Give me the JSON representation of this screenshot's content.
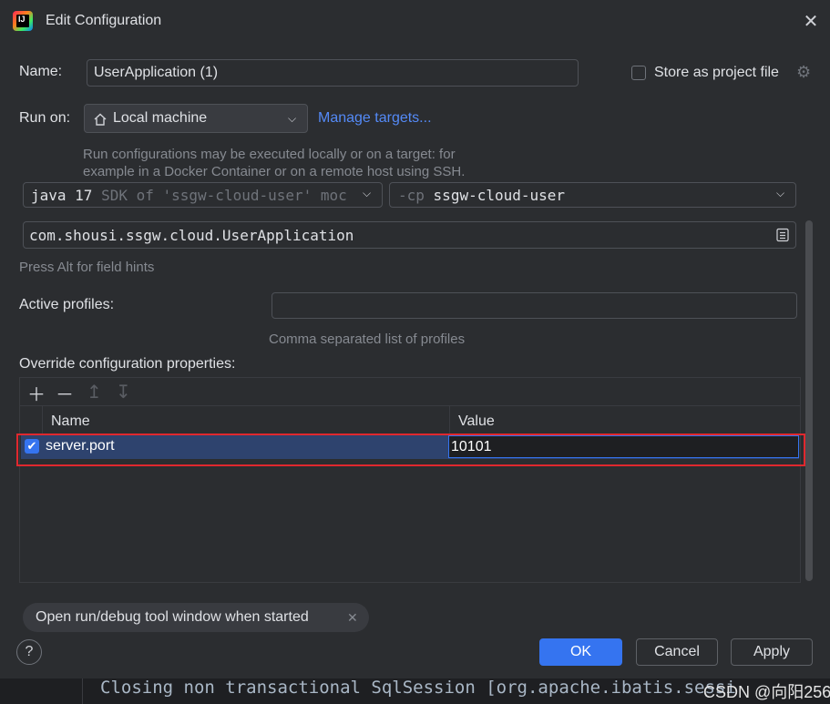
{
  "window": {
    "title": "Edit Configuration",
    "icon": "intellij-idea-icon",
    "close_icon": "close-icon"
  },
  "name_row": {
    "label": "Name:",
    "value": "UserApplication (1)"
  },
  "store_project": {
    "label": "Store as project file",
    "checked": false,
    "icon": "gear-icon"
  },
  "run_on": {
    "label": "Run on:",
    "selected": "Local machine",
    "icon": "home-icon",
    "manage_link": "Manage targets...",
    "hint_line1": "Run configurations may be executed locally or on a target: for",
    "hint_line2": "example in a Docker Container or on a remote host using SSH."
  },
  "sdk": {
    "version": "java 17",
    "detail": "SDK of 'ssgw-cloud-user' moc"
  },
  "classpath": {
    "prefix": "-cp",
    "module": "ssgw-cloud-user"
  },
  "main_class": {
    "value": "com.shousi.ssgw.cloud.UserApplication",
    "icon": "browse-icon"
  },
  "field_hints": "Press Alt for field hints",
  "active_profiles": {
    "label": "Active profiles:",
    "value": "",
    "hint": "Comma separated list of profiles"
  },
  "override": {
    "label": "Override configuration properties:",
    "toolbar": {
      "add_icon": "plus-icon",
      "remove_icon": "minus-icon",
      "up_icon": "move-up-icon",
      "down_icon": "move-down-icon"
    },
    "columns": [
      "Name",
      "Value"
    ],
    "rows": [
      {
        "checked": true,
        "name": "server.port",
        "value": "10101"
      }
    ]
  },
  "option_chip": {
    "label": "Open run/debug tool window when started",
    "icon": "close-icon"
  },
  "buttons": {
    "help": "?",
    "ok": "OK",
    "cancel": "Cancel",
    "apply": "Apply"
  },
  "background": {
    "console_text": "Closing non transactional SqlSession [org.apache.ibatis.sessi",
    "watermark": "CSDN @向阳256"
  },
  "colors": {
    "accent": "#3574f0",
    "link": "#548af7",
    "highlight_box": "#e0282e",
    "selected_row": "#2e436e"
  }
}
